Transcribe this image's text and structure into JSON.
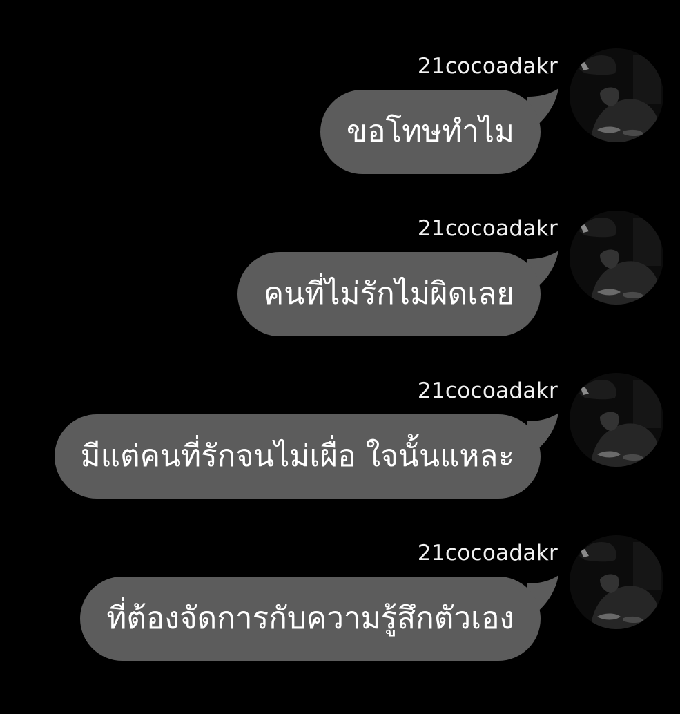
{
  "colors": {
    "background": "#000000",
    "bubble": "#5c5c5c",
    "text": "#ffffff",
    "sender_text": "#f2f2f2"
  },
  "messages": [
    {
      "sender": "21cocoadakr",
      "text": "ขอโทษทำไม",
      "avatar_icon": "user-avatar-photo"
    },
    {
      "sender": "21cocoadakr",
      "text": "คนที่ไม่รักไม่ผิดเลย",
      "avatar_icon": "user-avatar-photo"
    },
    {
      "sender": "21cocoadakr",
      "text": "มีแต่คนที่รักจนไม่เผื่อ ใจนั้นแหละ",
      "avatar_icon": "user-avatar-photo"
    },
    {
      "sender": "21cocoadakr",
      "text": "ที่ต้องจัดการกับความรู้สึกตัวเอง",
      "avatar_icon": "user-avatar-photo"
    }
  ]
}
